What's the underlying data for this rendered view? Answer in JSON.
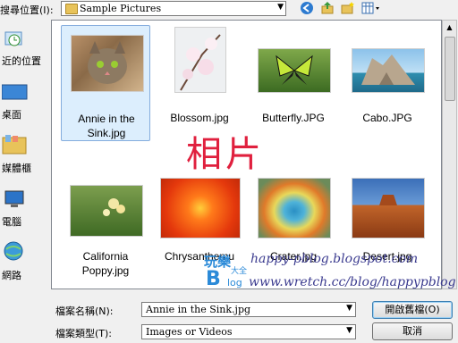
{
  "dialog": {
    "look_in_label": "搜尋位置(I):",
    "look_in_value": "Sample Pictures",
    "toolbar": {
      "back_icon": "back-arrow-icon",
      "up_icon": "up-folder-icon",
      "new_folder_icon": "new-folder-icon",
      "views_icon": "views-menu-icon"
    }
  },
  "places": [
    {
      "label": "近的位置",
      "icon": "recent-places-icon"
    },
    {
      "label": "桌面",
      "icon": "desktop-icon"
    },
    {
      "label": "媒體櫃",
      "icon": "libraries-icon"
    },
    {
      "label": "電腦",
      "icon": "computer-icon"
    },
    {
      "label": "網路",
      "icon": "network-icon"
    }
  ],
  "files": [
    {
      "name": "Annie in the Sink.jpg",
      "line1": "Annie in the",
      "line2": "Sink.jpg",
      "selected": true
    },
    {
      "name": "Blossom.jpg",
      "line1": "Blossom.jpg",
      "line2": ""
    },
    {
      "name": "Butterfly.JPG",
      "line1": "Butterfly.JPG",
      "line2": ""
    },
    {
      "name": "Cabo.JPG",
      "line1": "Cabo.JPG",
      "line2": ""
    },
    {
      "name": "California Poppy.jpg",
      "line1": "California",
      "line2": "Poppy.jpg"
    },
    {
      "name": "Chrysanthemum",
      "line1": "Chrysanthemu",
      "line2": ""
    },
    {
      "name": "Crater.jpg",
      "line1": "Crater.jpg",
      "line2": ""
    },
    {
      "name": "Desert.jpg",
      "line1": "Desert.jpg",
      "line2": ""
    }
  ],
  "bottom": {
    "filename_label": "檔案名稱(N):",
    "filename_value": "Annie in the Sink.jpg",
    "filetype_label": "檔案類型(T):",
    "filetype_value": "Images or Videos",
    "open_button": "開啟舊檔(O)",
    "cancel_button": "取消"
  },
  "watermark": {
    "center_text": "相片",
    "blog_line1": "happy-pblog.blogspot.com",
    "blog_line2": "www.wretch.cc/blog/happypblog",
    "logo_chars": [
      "玩樂",
      "B",
      "log",
      "大全"
    ]
  },
  "colors": {
    "selection_bg": "#dceefd",
    "selection_border": "#84acdd",
    "watermark_red": "#e0203e",
    "watermark_blue": "#3b3b8f"
  }
}
